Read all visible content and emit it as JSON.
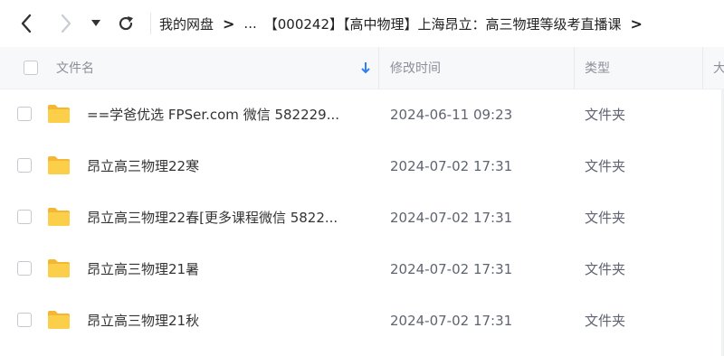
{
  "toolbar": {
    "back_icon": "chevron-left-icon",
    "forward_icon": "chevron-right-icon",
    "dropdown_icon": "caret-down-icon",
    "refresh_icon": "refresh-icon",
    "breadcrumb": {
      "root": "我的网盘",
      "ellipsis": "...",
      "current": "【000242】【高中物理】上海昂立：高三物理等级考直播课",
      "separator": ">"
    }
  },
  "table": {
    "headers": {
      "name": "文件名",
      "modified": "修改时间",
      "type": "类型",
      "size": "大"
    },
    "sort_icon": "sort-down-arrow-icon",
    "rows": [
      {
        "name": "==学爸优选 FPSer.com 微信 582229...",
        "modified": "2024-06-11 09:23",
        "type": "文件夹"
      },
      {
        "name": "昂立高三物理22寒",
        "modified": "2024-07-02 17:31",
        "type": "文件夹"
      },
      {
        "name": "昂立高三物理22春[更多课程微信 5822...",
        "modified": "2024-07-02 17:31",
        "type": "文件夹"
      },
      {
        "name": "昂立高三物理21暑",
        "modified": "2024-07-02 17:31",
        "type": "文件夹"
      },
      {
        "name": "昂立高三物理21秋",
        "modified": "2024-07-02 17:31",
        "type": "文件夹"
      }
    ]
  },
  "colors": {
    "folder": "#f9c846",
    "header_bg": "#f7f8fa",
    "sort_arrow": "#2f7ff5"
  }
}
